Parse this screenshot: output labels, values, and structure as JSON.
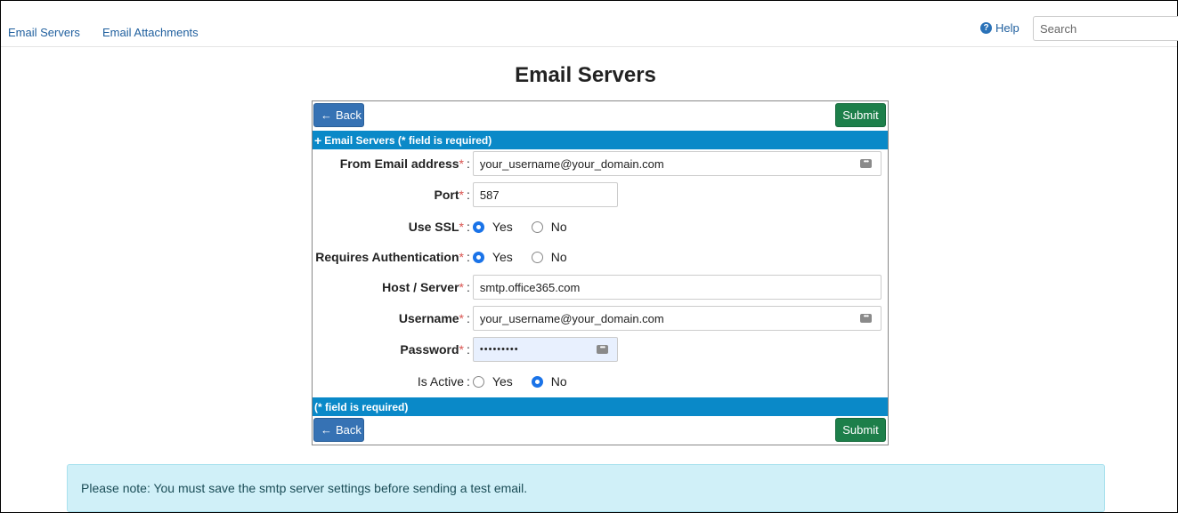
{
  "nav": {
    "links": [
      "Email Servers",
      "Email Attachments"
    ],
    "help_label": "Help",
    "search_placeholder": "Search"
  },
  "page": {
    "title": "Email Servers"
  },
  "form": {
    "back_label": "Back",
    "submit_label": "Submit",
    "header_bar": "Email Servers (* field is required)",
    "footer_bar": "(* field is required)",
    "fields": {
      "from_email": {
        "label": "From Email address",
        "value": "your_username@your_domain.com"
      },
      "port": {
        "label": "Port",
        "value": "587"
      },
      "use_ssl": {
        "label": "Use SSL",
        "selected": "Yes"
      },
      "requires_auth": {
        "label": "Requires Authentication",
        "selected": "Yes"
      },
      "host": {
        "label": "Host / Server",
        "value": "smtp.office365.com"
      },
      "username": {
        "label": "Username",
        "value": "your_username@your_domain.com"
      },
      "password": {
        "label": "Password",
        "value": "•••••••••"
      },
      "is_active": {
        "label": "Is Active",
        "selected": "No"
      }
    },
    "radio_options": {
      "yes": "Yes",
      "no": "No"
    },
    "required_mark": "*",
    "colon": ":"
  },
  "note": {
    "text": "Please note: You must save the smtp server settings before sending a test email."
  },
  "colors": {
    "bar": "#0a89c8",
    "back": "#3672b4",
    "submit": "#1d7f4a",
    "required": "#d9534f"
  }
}
